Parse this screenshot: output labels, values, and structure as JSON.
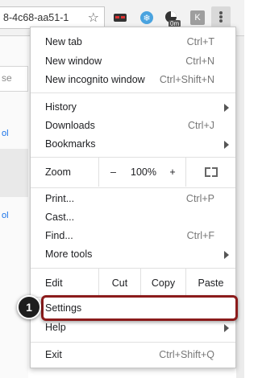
{
  "toolbar": {
    "url_fragment": "8-4c68-aa51-1",
    "star_icon": "star-outline",
    "ext_timer_badge": "0m",
    "ext_k_label": "K",
    "menu_icon": "vertical-dots"
  },
  "page": {
    "sliver_text_1": "se",
    "sliver_link_1": "ol",
    "sliver_link_2": "ol"
  },
  "menu": {
    "new_tab": {
      "label": "New tab",
      "shortcut": "Ctrl+T"
    },
    "new_window": {
      "label": "New window",
      "shortcut": "Ctrl+N"
    },
    "new_incognito": {
      "label": "New incognito window",
      "shortcut": "Ctrl+Shift+N"
    },
    "history": {
      "label": "History"
    },
    "downloads": {
      "label": "Downloads",
      "shortcut": "Ctrl+J"
    },
    "bookmarks": {
      "label": "Bookmarks"
    },
    "zoom": {
      "label": "Zoom",
      "minus": "–",
      "value": "100%",
      "plus": "+"
    },
    "print": {
      "label": "Print...",
      "shortcut": "Ctrl+P"
    },
    "cast": {
      "label": "Cast..."
    },
    "find": {
      "label": "Find...",
      "shortcut": "Ctrl+F"
    },
    "more_tools": {
      "label": "More tools"
    },
    "edit": {
      "label": "Edit",
      "cut": "Cut",
      "copy": "Copy",
      "paste": "Paste"
    },
    "settings": {
      "label": "Settings"
    },
    "help": {
      "label": "Help"
    },
    "exit": {
      "label": "Exit",
      "shortcut": "Ctrl+Shift+Q"
    }
  },
  "annotation": {
    "step_number": "1",
    "color": "#8b1b1b"
  }
}
